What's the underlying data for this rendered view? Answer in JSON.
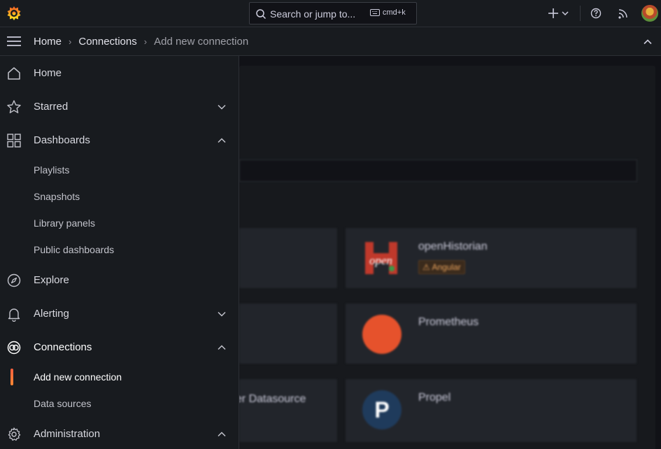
{
  "topbar": {
    "search_placeholder": "Search or jump to...",
    "search_shortcut": "cmd+k",
    "icons": [
      "grafana-logo-icon",
      "search-icon",
      "keyboard-icon",
      "plus-icon",
      "chevron-down-icon",
      "help-icon",
      "rss-icon",
      "avatar"
    ]
  },
  "breadcrumb": {
    "items": [
      "Home",
      "Connections",
      "Add new connection"
    ]
  },
  "sidebar": {
    "home": "Home",
    "starred": "Starred",
    "dashboards": "Dashboards",
    "dashboards_children": [
      "Playlists",
      "Snapshots",
      "Library panels",
      "Public dashboards"
    ],
    "explore": "Explore",
    "alerting": "Alerting",
    "connections": "Connections",
    "connections_children": [
      "Add new connection",
      "Data sources"
    ],
    "administration": "Administration"
  },
  "background": {
    "cards": [
      {
        "name": "openHistorian",
        "badge": "Angular"
      },
      {
        "name": "Prometheus"
      },
      {
        "name": "Propel"
      }
    ],
    "partial_text": "ger Datasource"
  },
  "colors": {
    "accent": "#f55f3e",
    "sidebar_bg": "#181b1f",
    "page_bg": "#111217"
  }
}
